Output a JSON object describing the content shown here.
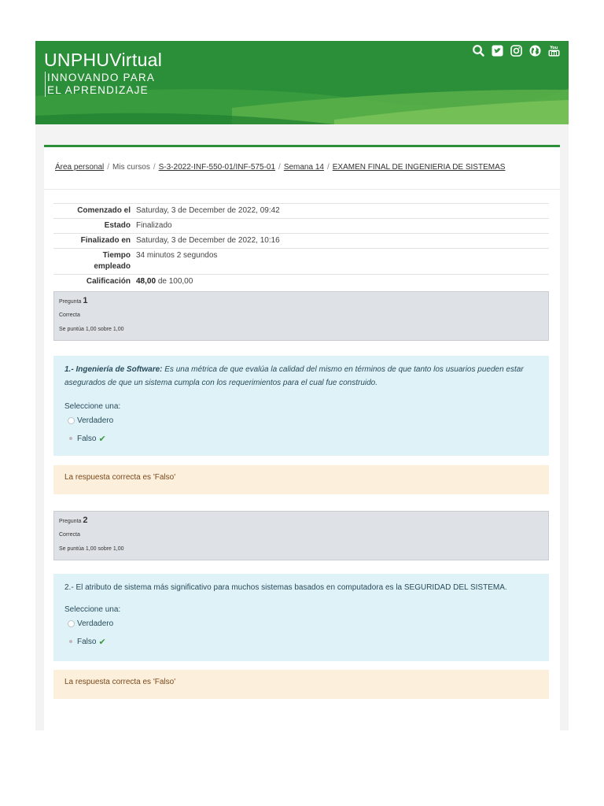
{
  "brand": {
    "name": "UNPHUVirtual",
    "tagline": [
      "INNOVANDO PARA",
      "EL APRENDIZAJE"
    ]
  },
  "header_icons": [
    "search-icon",
    "twitter-icon",
    "instagram-icon",
    "globe-icon",
    "youtube-icon"
  ],
  "colors": {
    "header_green": "#2a8f38",
    "info_bg": "#def2f8",
    "feedback_bg": "#fcefdc",
    "check": "#3c9a3c"
  },
  "breadcrumb": [
    "Área personal",
    "Mis cursos",
    "S-3-2022-INF-550-01/INF-575-01",
    "Semana 14",
    "EXAMEN FINAL DE INGENIERIA DE SISTEMAS"
  ],
  "summary": {
    "started_label": "Comenzado el",
    "started_value": "Saturday, 3 de December de 2022, 09:42",
    "state_label": "Estado",
    "state_value": "Finalizado",
    "finished_label": "Finalizado en",
    "finished_value": "Saturday, 3 de December de 2022, 10:16",
    "time_label_1": "Tiempo",
    "time_label_2": "empleado",
    "time_value": "34 minutos 2 segundos",
    "grade_label": "Calificación",
    "grade_value": "48,00",
    "grade_suffix": "de 100,00"
  },
  "questions": [
    {
      "label": "Pregunta",
      "number": "1",
      "state": "Correcta",
      "grade": "Se puntúa 1,00 sobre 1,00",
      "text_bold": "1.- Ingeniería de Software:",
      "text_rest": " Es una métrica de que evalúa la calidad del mismo en términos de que tanto los usuarios pueden estar asegurados de que un sistema cumpla con los requerimientos para el cual fue construido.",
      "prompt": "Seleccione una:",
      "options": [
        "Verdadero",
        "Falso"
      ],
      "feedback": "La respuesta correcta es 'Falso'"
    },
    {
      "label": "Pregunta",
      "number": "2",
      "state": "Correcta",
      "grade": "Se puntúa 1,00 sobre 1,00",
      "text": "2.- El atributo de sistema más significativo para muchos sistemas basados en computadora es la SEGURIDAD DEL SISTEMA.",
      "prompt": "Seleccione una:",
      "options": [
        "Verdadero",
        "Falso"
      ],
      "feedback": "La respuesta correcta es 'Falso'"
    }
  ]
}
